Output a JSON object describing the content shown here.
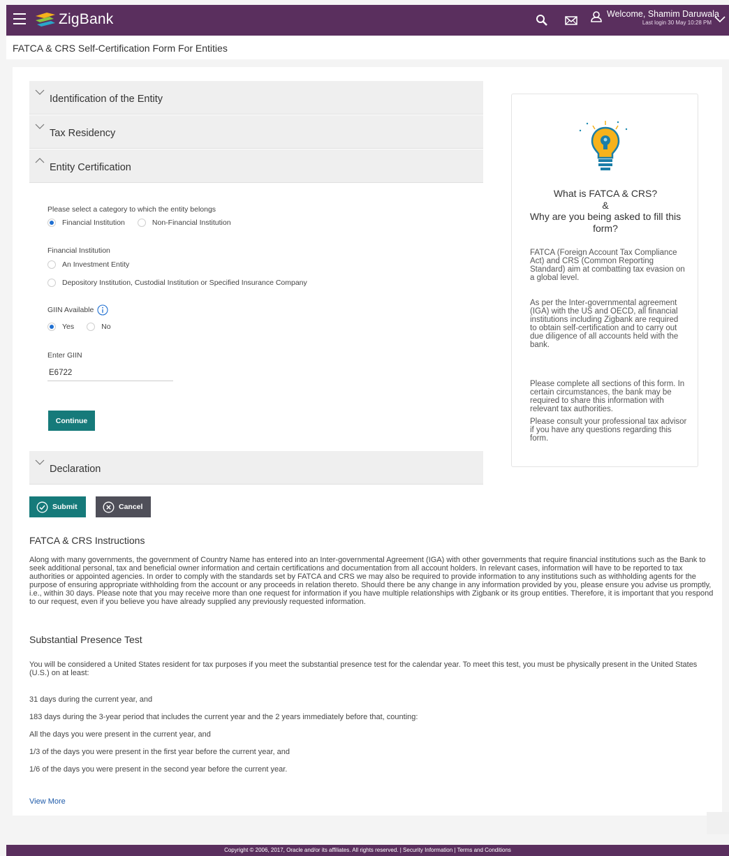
{
  "header": {
    "brand": "ZigBank",
    "welcome": "Welcome, Shamim Daruwala",
    "last_login": "Last login 30 May 10:28 PM",
    "icons": [
      "menu-icon",
      "search-icon",
      "mail-icon",
      "user-icon",
      "chevron-down-icon"
    ],
    "bar_color": "#5a2f5e"
  },
  "page_title": "FATCA & CRS Self-Certification Form For Entities",
  "accordion": {
    "identification": "Identification of the Entity",
    "tax_residency": "Tax Residency",
    "entity_certification": "Entity Certification",
    "declaration": "Declaration"
  },
  "form": {
    "category_label": "Please select a category to which the entity belongs",
    "category_options": [
      "Financial Institution",
      "Non-Financial Institution"
    ],
    "category_selected": "Financial Institution",
    "fi_label": "Financial Institution",
    "fi_options": [
      "An Investment Entity",
      "Depository Institution, Custodial Institution or Specified Insurance Company"
    ],
    "giin_available_label": "GIIN Available",
    "giin_options": [
      "Yes",
      "No"
    ],
    "giin_selected": "Yes",
    "enter_giin_label": "Enter GIIN",
    "giin_value": "E6722",
    "continue_label": "Continue"
  },
  "actions": {
    "submit": "Submit",
    "cancel": "Cancel",
    "primary_color": "#167a7a"
  },
  "side_card": {
    "question_line1": "What is FATCA & CRS?",
    "question_amp": "&",
    "question_line2": "Why are you being asked to fill this form?",
    "p1": "FATCA (Foreign Account Tax Compliance Act) and CRS (Common Reporting Standard) aim at combatting tax evasion on a global level.",
    "p2": "As per the Inter-governmental agreement (IGA) with the US and OECD, all financial institutions including Zigbank are required to obtain self-certification and to carry out due diligence of all accounts held with the bank.",
    "p3": "Please complete all sections of this form. In certain circumstances, the bank may be required to share this information with relevant tax authorities.",
    "p4": "Please consult your professional tax advisor if you have any questions regarding this form."
  },
  "instructions": {
    "title": "FATCA & CRS Instructions",
    "body": "Along with many governments, the government of Country Name has entered into an Inter-governmental Agreement (IGA) with other governments that require financial institutions such as the Bank to seek additional personal, tax and beneficial owner information and certain certifications and documentation from all account holders. In relevant cases, information will have to be reported to tax authorities or appointed agencies. In order to comply with the standards set by FATCA and CRS we may also be required to provide information to any institutions such as withholding agents for the purpose of ensuring appropriate withholding from the account or any proceeds in relation thereto. Should there be any change in any information provided by you, please ensure you advise us promptly, i.e., within 30 days. Please note that you may receive more than one request for information if you have multiple relationships with Zigbank or its group entities. Therefore, it is important that you respond to our request, even if you believe you have already supplied any previously requested information."
  },
  "presence_test": {
    "title": "Substantial Presence Test",
    "intro": "You will be considered a United States resident for tax purposes if you meet the substantial presence test for the calendar year. To meet this test, you must be physically present in the United States (U.S.) on at least:",
    "lines": [
      "31 days during the current year, and",
      "183 days during the 3-year period that includes the current year and the 2 years immediately before that, counting:",
      "All the days you were present in the current year, and",
      "1/3 of the days you were present in the first year before the current year, and",
      "1/6 of the days you were present in the second year before the current year."
    ],
    "view_more": "View More"
  },
  "footer": {
    "copyright": "Copyright © 2006, 2017, Oracle and/or its affiliates. All rights reserved.",
    "sep": " | ",
    "security": "Security Information",
    "terms": "Terms and Conditions"
  }
}
